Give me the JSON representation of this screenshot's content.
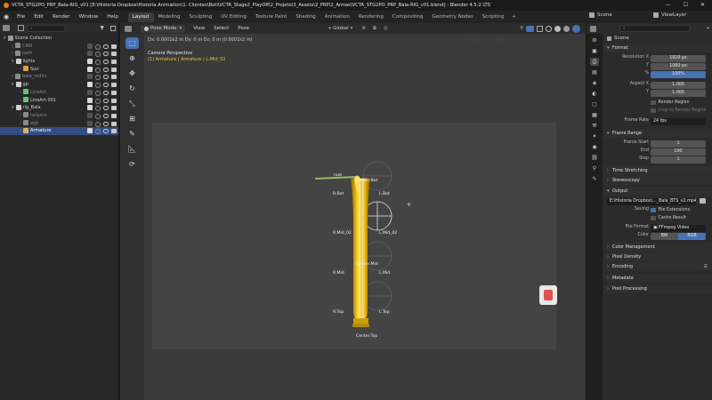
{
  "window": {
    "title": "VCTA_STG2PO_PRP_Bala-RIG_v01 [E:\\Historia Dropbox\\Historia Animation\\1. Clientes\\Boti\\VCTA_Stage2_PlayOff\\2_Projeto\\3_Assets\\2_PRP\\2_Armas\\VCTA_STG2PO_PRP_Bala-RIG_v01.blend] - Blender 4.5.2 LTS",
    "minimize": "—",
    "maximize": "☐",
    "close": "✕"
  },
  "menu": {
    "blender_logo": "◉",
    "items": [
      "File",
      "Edit",
      "Render",
      "Window",
      "Help"
    ],
    "workspaces": [
      "Layout",
      "Modeling",
      "Sculpting",
      "UV Editing",
      "Texture Paint",
      "Shading",
      "Animation",
      "Rendering",
      "Compositing",
      "Geometry Nodes",
      "Scripting"
    ],
    "active_workspace": "Layout",
    "add_tab": "+",
    "scene_label": "Scene",
    "viewlayer_label": "ViewLayer"
  },
  "outliner": {
    "search_placeholder": "",
    "rows": [
      {
        "label": "Scene Collection",
        "indent": 0,
        "icon_color": "#9a9a9a",
        "has_vis": false,
        "selected": false
      },
      {
        "label": "CAM",
        "indent": 1,
        "icon_color": "#8a8a8a",
        "has_vis": true,
        "checked": false,
        "selected": false
      },
      {
        "label": "path",
        "indent": 1,
        "icon_color": "#8a8a8a",
        "has_vis": true,
        "checked": false,
        "selected": false
      },
      {
        "label": "lights",
        "indent": 1,
        "icon_color": "#d0d0d0",
        "has_vis": true,
        "checked": true,
        "selected": false
      },
      {
        "label": "Sun",
        "indent": 2,
        "icon_color": "#e0a040",
        "has_vis": true,
        "checked": true,
        "selected": false
      },
      {
        "label": "bala_redirs",
        "indent": 1,
        "icon_color": "#8a8a8a",
        "has_vis": true,
        "checked": false,
        "selected": false
      },
      {
        "label": "gp",
        "indent": 1,
        "icon_color": "#d0d0d0",
        "has_vis": true,
        "checked": true,
        "selected": false
      },
      {
        "label": "LineArt",
        "indent": 2,
        "icon_color": "#70c070",
        "has_vis": true,
        "checked": false,
        "selected": false
      },
      {
        "label": "LineArt.001",
        "indent": 2,
        "icon_color": "#70c070",
        "has_vis": true,
        "checked": true,
        "selected": false
      },
      {
        "label": "rig_Bala",
        "indent": 1,
        "icon_color": "#d0d0d0",
        "has_vis": true,
        "checked": true,
        "selected": false
      },
      {
        "label": "helpers",
        "indent": 2,
        "icon_color": "#8a8a8a",
        "has_vis": true,
        "checked": false,
        "selected": false
      },
      {
        "label": "wgt",
        "indent": 2,
        "icon_color": "#8a8a8a",
        "has_vis": true,
        "checked": false,
        "selected": false
      },
      {
        "label": "Armature",
        "indent": 2,
        "icon_color": "#e0b060",
        "has_vis": true,
        "checked": true,
        "selected": true
      }
    ]
  },
  "viewport": {
    "mode": "Pose Mode",
    "menus": [
      "View",
      "Select",
      "Pose"
    ],
    "orientation": "Global",
    "status_text": "Dx: 0.0001k2 m  Dy: 0 m  Dz: 0 m (0.0001k2 m)",
    "view_name": "Camera Perspective",
    "active_info_prefix": "(1) Armature | Armature | ",
    "active_bone": "L.Mid_02",
    "bones": [
      "root",
      "Center.Bot",
      "R.Bot",
      "L.Bot",
      "R.Mid_02",
      "L.Mid_02",
      "Center.Mid",
      "R.Mid",
      "L.Mid",
      "R.Top",
      "L.Top",
      "Center.Top"
    ]
  },
  "properties": {
    "header_label": "Scene",
    "sections": {
      "format": "Format",
      "frame_range": "Frame Range",
      "time_stretching": "Time Stretching",
      "stereoscopy": "Stereoscopy",
      "output": "Output",
      "color_management": "Color Management",
      "pixel_density": "Pixel Density",
      "encoding": "Encoding",
      "metadata": "Metadata",
      "post_processing": "Post Processing"
    },
    "resolution_x_label": "Resolution X",
    "resolution_x": "1920 px",
    "resolution_y_label": "Y",
    "resolution_y": "1080 px",
    "percent_label": "%",
    "percent": "100%",
    "aspect_x_label": "Aspect X",
    "aspect_x": "1.000",
    "aspect_y_label": "Y",
    "aspect_y": "1.000",
    "render_region": "Render Region",
    "crop_region": "Crop to Render Region",
    "frame_rate_label": "Frame Rate",
    "frame_rate": "24 fps",
    "frame_start_label": "Frame Start",
    "frame_start": "1",
    "end_label": "End",
    "end": "100",
    "step_label": "Step",
    "step": "1",
    "output_path": "E:\\Historia Dropbox\\..._Bala_BTS_v2.mp4",
    "saving_label": "Saving",
    "file_extensions": "File Extensions",
    "cache_result": "Cache Result",
    "file_format_label": "File Format",
    "file_format": "FFmpeg Video",
    "color_label": "Color",
    "color_bw": "BW",
    "color_rgb": "RGB"
  },
  "colors": {
    "accent": "#4772b3",
    "bullet": "#e8b400",
    "selected_text": "#ffffff"
  }
}
